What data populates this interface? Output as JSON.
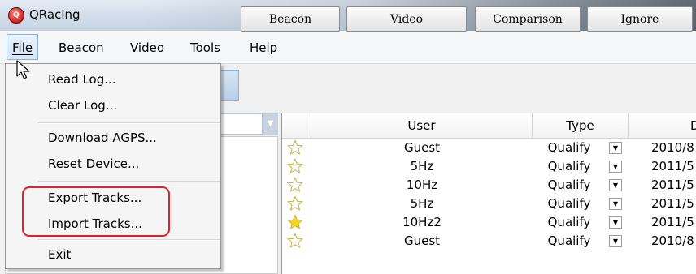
{
  "window": {
    "title": "QRacing"
  },
  "menubar": {
    "items": [
      {
        "label": "File",
        "mnemonic": "F"
      },
      {
        "label": "Beacon",
        "mnemonic": "B"
      },
      {
        "label": "Video",
        "mnemonic": ""
      },
      {
        "label": "Tools",
        "mnemonic": "T"
      },
      {
        "label": "Help",
        "mnemonic": "H"
      }
    ]
  },
  "toolbar": {
    "buttons": [
      "Beacon",
      "Video",
      "Comparison",
      "Ignore"
    ]
  },
  "file_menu": {
    "items": [
      "Read Log...",
      "Clear Log...",
      "Download AGPS...",
      "Reset Device...",
      "Export Tracks...",
      "Import Tracks...",
      "Exit"
    ]
  },
  "table": {
    "columns": [
      "User",
      "Type",
      "D"
    ],
    "rows": [
      {
        "starred": false,
        "user": "Guest",
        "type": "Qualify",
        "date": "2010/8"
      },
      {
        "starred": false,
        "user": "5Hz",
        "type": "Qualify",
        "date": "2011/5"
      },
      {
        "starred": false,
        "user": "10Hz",
        "type": "Qualify",
        "date": "2011/5"
      },
      {
        "starred": false,
        "user": "5Hz",
        "type": "Qualify",
        "date": "2011/5"
      },
      {
        "starred": true,
        "user": "10Hz2",
        "type": "Qualify",
        "date": "2011/5"
      },
      {
        "starred": false,
        "user": "Guest",
        "type": "Qualify",
        "date": "2010/8"
      }
    ]
  },
  "colors": {
    "highlight_box": "#e0202a",
    "star_filled": "#f7d51d",
    "star_outline": "#c9b24a"
  }
}
